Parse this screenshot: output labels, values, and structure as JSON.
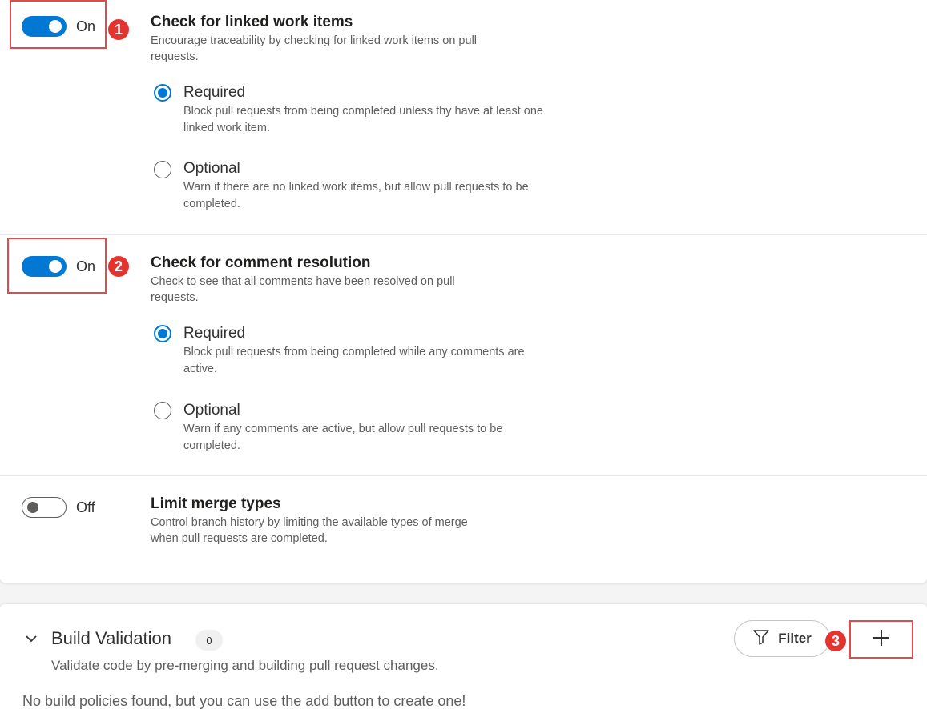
{
  "policies": [
    {
      "toggle_label": "On",
      "badge": "1",
      "title": "Check for linked work items",
      "description": "Encourage traceability by checking for linked work items on pull requests.",
      "options": [
        {
          "title": "Required",
          "description": "Block pull requests from being completed unless thy have at least one linked work item.",
          "selected": true
        },
        {
          "title": "Optional",
          "description": "Warn if there are no linked work items, but allow pull requests to be completed.",
          "selected": false
        }
      ]
    },
    {
      "toggle_label": "On",
      "badge": "2",
      "title": "Check for comment resolution",
      "description": "Check to see that all comments have been resolved on pull requests.",
      "options": [
        {
          "title": "Required",
          "description": "Block pull requests from being completed while any comments are active.",
          "selected": true
        },
        {
          "title": "Optional",
          "description": "Warn if any comments are active, but allow pull requests to be completed.",
          "selected": false
        }
      ]
    },
    {
      "toggle_label": "Off",
      "title": "Limit merge types",
      "description": "Control branch history by limiting the available types of merge when pull requests are completed."
    }
  ],
  "build_validation": {
    "title": "Build Validation",
    "count": "0",
    "description": "Validate code by pre-merging and building pull request changes.",
    "empty_message": "No build policies found, but you can use the add button to create one!",
    "filter_label": "Filter",
    "add_badge": "3"
  },
  "colors": {
    "accent": "#0078d4",
    "annotation": "#e3342f"
  },
  "icons": {
    "chevron": "chevron-down-icon",
    "filter": "filter-icon",
    "add": "plus-icon"
  }
}
